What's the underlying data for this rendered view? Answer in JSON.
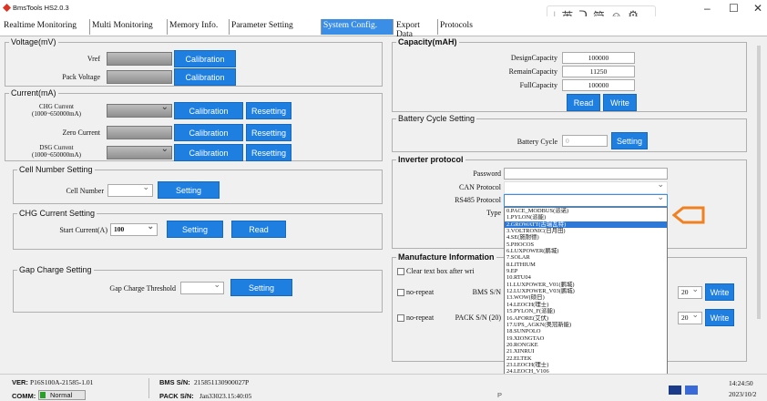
{
  "window": {
    "title": "BmsTools HS2.0.3",
    "ime": [
      "英",
      "ᑐ",
      "简",
      "☺",
      "⚙"
    ]
  },
  "tabs": [
    "Realtime Monitoring",
    "Multi Monitoring",
    "Memory Info.",
    "Parameter Setting",
    "System Config.",
    "Export Data",
    "Protocols"
  ],
  "voltage": {
    "legend": "Voltage(mV)",
    "vref_label": "Vref",
    "pack_label": "Pack Voltage",
    "btn": "Calibration"
  },
  "current": {
    "legend": "Current(mA)",
    "chg_label": "CHG Current\n(1000~650000mA)",
    "zero_label": "Zero Current",
    "dsg_label": "DSG Current\n(1000~650000mA)",
    "calib": "Calibration",
    "reset": "Resetting"
  },
  "cellnum": {
    "legend": "Cell Number Setting",
    "label": "Cell Number",
    "btn": "Setting"
  },
  "chgcur": {
    "legend": "CHG Current Setting",
    "label": "Start Current(A)",
    "value": "100",
    "setting": "Setting",
    "read": "Read"
  },
  "gap": {
    "legend": "Gap Charge Setting",
    "label": "Gap Charge Threshold",
    "btn": "Setting"
  },
  "capacity": {
    "legend": "Capacity(mAH)",
    "design_label": "DesignCapacity",
    "design": "100000",
    "remain_label": "RemainCapacity",
    "remain": "11250",
    "full_label": "FullCapacity",
    "full": "100000",
    "read": "Read",
    "write": "Write"
  },
  "cycle": {
    "legend": "Battery Cycle Setting",
    "label": "Battery Cycle",
    "value": "0",
    "btn": "Setting"
  },
  "inverter": {
    "legend": "Inverter protocol",
    "password": "Password",
    "can": "CAN Protocol",
    "rs485": "RS485 Protocol",
    "type": "Type"
  },
  "manufacture": {
    "legend": "Manufacture Information",
    "clear": "Clear text box after wri",
    "norepeat1": "no-repeat",
    "bms_sn": "BMS S/N",
    "norepeat2": "no-repeat",
    "pack_sn": "PACK S/N (20)",
    "num1": "20",
    "num2": "20",
    "write": "Write"
  },
  "options": [
    "0.PACE_MODBUS(派诺)",
    "1.PYLON(派能)",
    "2.GROWATT(古瑞瓦特)",
    "3.VOLTRONIC(日月田)",
    "4.SE(施耐德)",
    "5.PHOCOS",
    "6.LUXPOWER(鹏城)",
    "7.SOLAR",
    "8.LITHIUM",
    "9.EP",
    "10.RTU04",
    "11.LUXPOWER_V01(鹏城)",
    "12.LUXPOWER_V03(鹏城)",
    "13.WOW(硕日)",
    "14.LEOCH(理士)",
    "15.PYLON_F(派能)",
    "16.AFORE(艾伏)",
    "17.UPS_AGKN(奥冠新能)",
    "18.SUNPOLO",
    "19.XIONGTAO",
    "20.RONGKE",
    "21.XINRUI",
    "22.ELTEK",
    "23.LEOCH(理士)",
    "24.LEOCH_V106"
  ],
  "status": {
    "ver_label": "VER:",
    "ver": "P16S100A-21585-1.01",
    "bms_label": "BMS S/N:",
    "bms": "215851130900027P",
    "comm_label": "COMM:",
    "comm": "Normal",
    "pack_label": "PACK S/N:",
    "pack": "Jan33023.15:40:05",
    "time": "14:24:50",
    "date": "2023/10/2",
    "pc": "P"
  }
}
